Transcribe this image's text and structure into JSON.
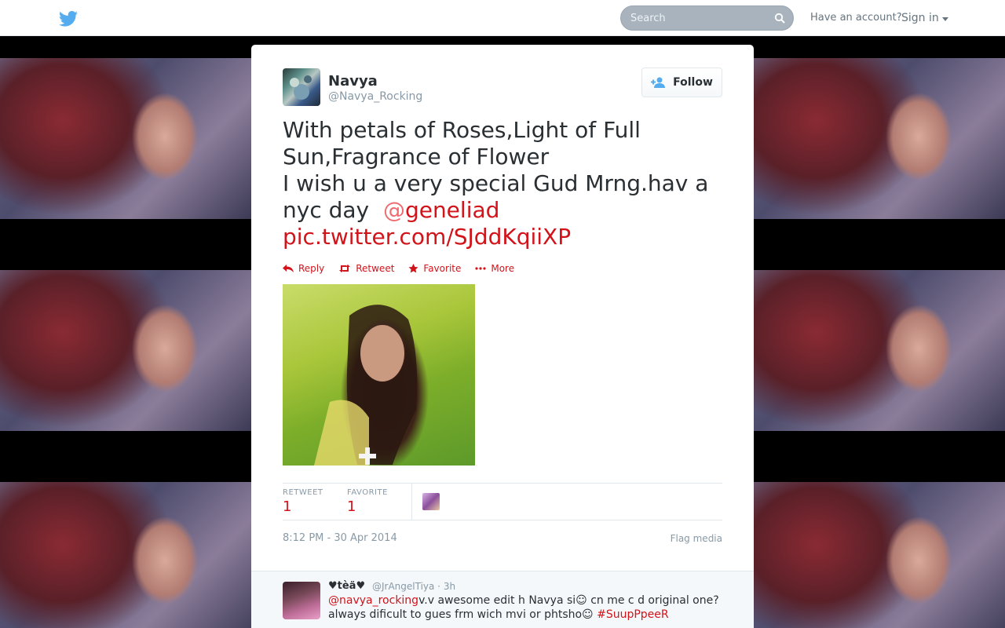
{
  "header": {
    "search_placeholder": "Search",
    "have_account": "Have an account?",
    "sign_in": "Sign in"
  },
  "tweet": {
    "display_name": "Navya",
    "handle": "@Navya_Rocking",
    "follow_label": "Follow",
    "text_line1": "With petals of Roses,Light of Full Sun,Fragrance of Flower",
    "text_line2": "I wish u a very special Gud Mrng.hav a nyc day",
    "mention_at": "@",
    "mention_name": "geneliad",
    "link": "pic.twitter.com/SJddKqiiXP",
    "actions": {
      "reply": "Reply",
      "retweet": "Retweet",
      "favorite": "Favorite",
      "more": "More"
    },
    "stats": {
      "retweet_label": "RETWEET",
      "retweet_count": "1",
      "favorite_label": "FAVORITE",
      "favorite_count": "1"
    },
    "timestamp": "8:12 PM - 30 Apr 2014",
    "flag_media": "Flag media"
  },
  "reply": {
    "name": "♥tèä♥",
    "handle": "@JrAngelTiya · 3h",
    "mention": "@navya_rocking",
    "text_a": "v.v awesome edit h Navya si☺ cn me c d original one? always dificult to gues frm wich mvi or phtsho☺",
    "hashtag": "#SuupPpeeR"
  },
  "colors": {
    "accent": "#d2131a",
    "twitter_blue": "#55acee"
  }
}
